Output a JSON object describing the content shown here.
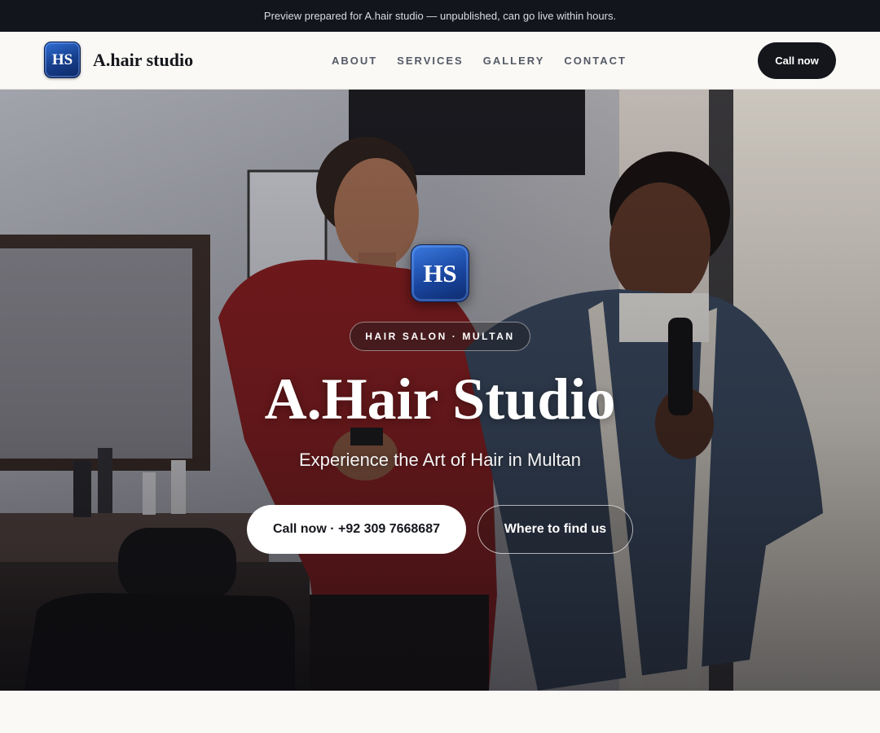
{
  "preview_banner": {
    "text": "Preview prepared for A.hair studio — unpublished, can go live within hours."
  },
  "header": {
    "logo_initials": "HS",
    "brand_name": "A.hair studio",
    "nav": [
      {
        "label": "ABOUT"
      },
      {
        "label": "SERVICES"
      },
      {
        "label": "GALLERY"
      },
      {
        "label": "CONTACT"
      }
    ],
    "cta_label": "Call now"
  },
  "hero": {
    "logo_initials": "HS",
    "tag": "HAIR SALON · MULTAN",
    "title": "A.Hair Studio",
    "subtitle": "Experience the Art of Hair in Multan",
    "primary_button": "Call now · +92 309 7668687",
    "secondary_button": "Where to find us"
  },
  "colors": {
    "preview_bar_bg": "#12151c",
    "page_bg": "#faf9f6",
    "dark_button": "#14161c",
    "logo_blue": "#1a46a0"
  }
}
